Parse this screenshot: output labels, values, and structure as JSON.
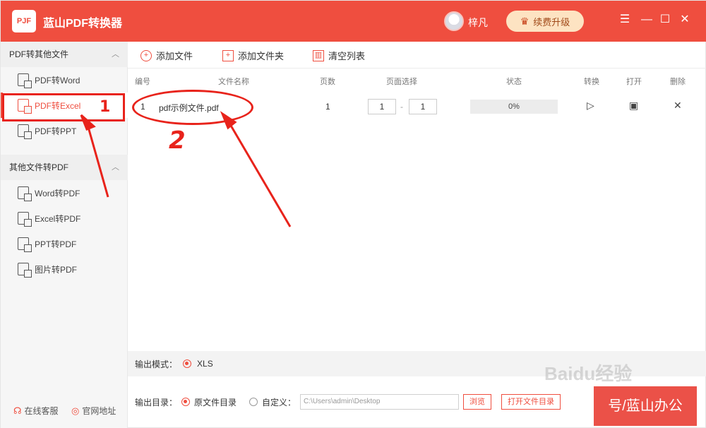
{
  "app": {
    "logo_text": "PJF",
    "title": "蓝山PDF转换器",
    "username": "梓凡",
    "vip_label": "续费升级",
    "controls": {
      "menu": "☰",
      "minimize": "—",
      "maximize": "☐",
      "close": "✕"
    }
  },
  "sidebar": {
    "group1_title": "PDF转其他文件",
    "group1_items": [
      {
        "label": "PDF转Word"
      },
      {
        "label": "PDF转Excel"
      },
      {
        "label": "PDF转PPT"
      }
    ],
    "group2_title": "其他文件转PDF",
    "group2_items": [
      {
        "label": "Word转PDF"
      },
      {
        "label": "Excel转PDF"
      },
      {
        "label": "PPT转PDF"
      },
      {
        "label": "图片转PDF"
      }
    ],
    "bottom": {
      "online_service": "在线客服",
      "website": "官网地址"
    }
  },
  "toolbar": {
    "add_file": "添加文件",
    "add_folder": "添加文件夹",
    "clear_list": "清空列表"
  },
  "table": {
    "headers": {
      "index": "编号",
      "filename": "文件名称",
      "pages": "页数",
      "page_select": "页面选择",
      "status": "状态",
      "convert": "转换",
      "open": "打开",
      "delete": "删除"
    },
    "rows": [
      {
        "index": "1",
        "filename": "pdf示例文件.pdf",
        "pages": "1",
        "page_from": "1",
        "page_to": "1",
        "progress": "0%"
      }
    ]
  },
  "output": {
    "mode_label": "输出模式：",
    "mode_option": "XLS",
    "dir_label": "输出目录：",
    "dir_option_original": "原文件目录",
    "dir_option_custom": "自定义：",
    "path_value": "C:\\Users\\admin\\Desktop",
    "browse": "浏览",
    "open_folder": "打开文件目录"
  },
  "annotations": {
    "mark1": "1",
    "mark2": "2"
  },
  "watermark": {
    "text": "Baidu经验",
    "banner": "号/蓝山办公"
  },
  "colors": {
    "accent": "#ef4e3f",
    "annotation": "#e8231b"
  }
}
